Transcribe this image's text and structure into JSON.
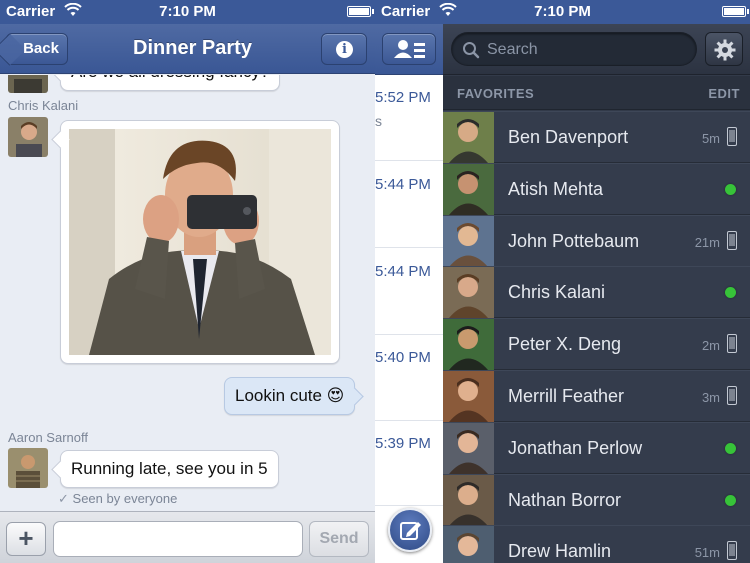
{
  "status": {
    "carrier": "Carrier",
    "time": "7:10 PM"
  },
  "chat": {
    "back_label": "Back",
    "title": "Dinner Party",
    "top_partial": "Are we all dressing fancy?",
    "sender1": "Chris Kalani",
    "my_message": "Lookin cute 😍",
    "sender2": "Aaron Sarnoff",
    "message2": "Running late, see you in 5",
    "seen": "Seen by everyone",
    "send_label": "Send",
    "input_value": ""
  },
  "threads": {
    "times": [
      "5:52 PM",
      "5:44 PM",
      "5:44 PM",
      "5:40 PM",
      "5:39 PM"
    ],
    "partial_s": "s"
  },
  "sidebar": {
    "search_placeholder": "Search",
    "section_label": "FAVORITES",
    "edit_label": "EDIT",
    "friends": [
      {
        "name": "Ben Davenport",
        "ago": "5m",
        "status": "mobile"
      },
      {
        "name": "Atish Mehta",
        "ago": "",
        "status": "online"
      },
      {
        "name": "John Pottebaum",
        "ago": "21m",
        "status": "mobile"
      },
      {
        "name": "Chris Kalani",
        "ago": "",
        "status": "online"
      },
      {
        "name": "Peter X. Deng",
        "ago": "2m",
        "status": "mobile"
      },
      {
        "name": "Merrill Feather",
        "ago": "3m",
        "status": "mobile"
      },
      {
        "name": "Jonathan Perlow",
        "ago": "",
        "status": "online"
      },
      {
        "name": "Nathan Borror",
        "ago": "",
        "status": "online"
      },
      {
        "name": "Drew Hamlin",
        "ago": "51m",
        "status": "mobile"
      }
    ]
  },
  "colors": {
    "facebook_blue": "#3b5998",
    "online_green": "#37c339",
    "sidebar_bg": "#323a49"
  }
}
